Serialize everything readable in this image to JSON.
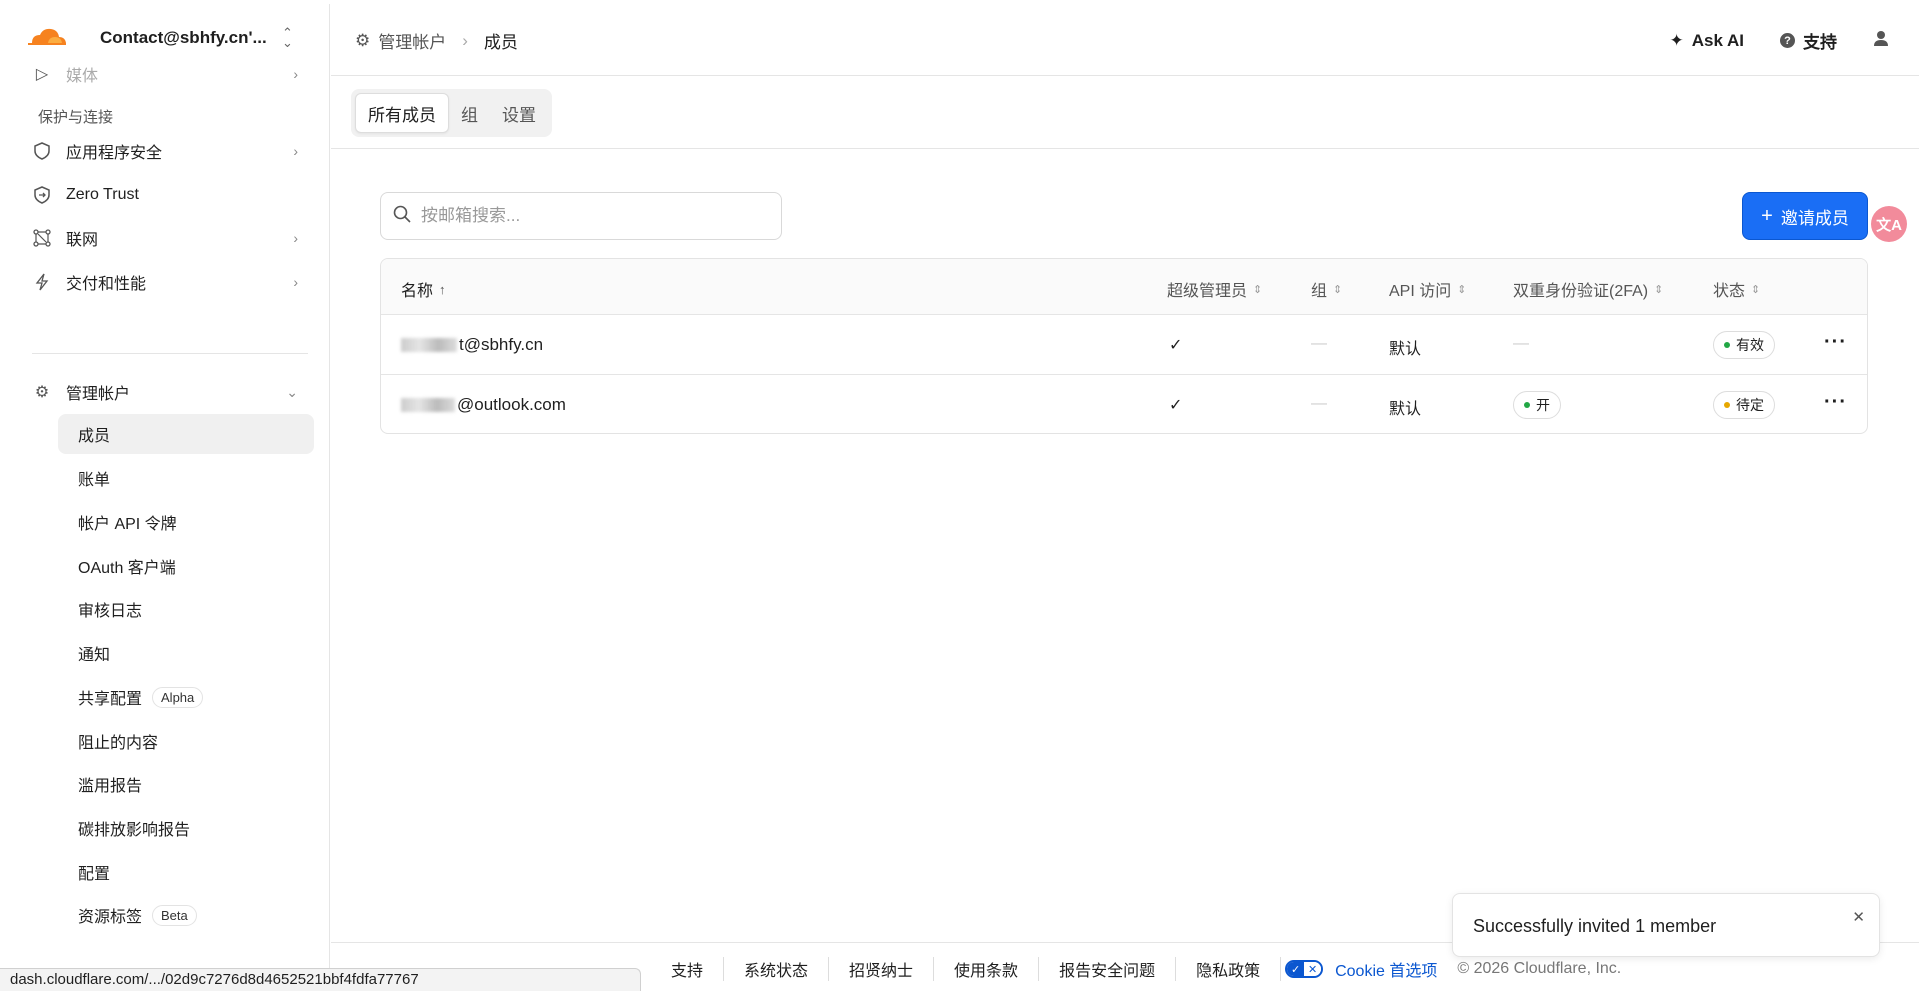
{
  "account": {
    "name": "Contact@sbhfy.cn'..."
  },
  "sidebar": {
    "partial_item": "媒体",
    "section_label": "保护与连接",
    "items": [
      {
        "label": "应用程序安全",
        "icon": "shield-icon"
      },
      {
        "label": "Zero Trust",
        "icon": "zero-trust-icon"
      },
      {
        "label": "联网",
        "icon": "network-icon"
      },
      {
        "label": "交付和性能",
        "icon": "lightning-icon"
      }
    ],
    "manage": {
      "label": "管理帐户",
      "icon": "gear-icon"
    },
    "sub_items": [
      {
        "label": "成员"
      },
      {
        "label": "账单"
      },
      {
        "label": "帐户 API 令牌"
      },
      {
        "label": "OAuth 客户端"
      },
      {
        "label": "审核日志"
      },
      {
        "label": "通知"
      },
      {
        "label": "共享配置",
        "tag": "Alpha"
      },
      {
        "label": "阻止的内容"
      },
      {
        "label": "滥用报告"
      },
      {
        "label": "碳排放影响报告"
      },
      {
        "label": "配置"
      },
      {
        "label": "资源标签",
        "tag": "Beta"
      }
    ]
  },
  "breadcrumb": {
    "parent": "管理帐户",
    "current": "成员"
  },
  "header": {
    "ask_ai": "Ask AI",
    "support": "支持"
  },
  "tabs": [
    {
      "label": "所有成员"
    },
    {
      "label": "组"
    },
    {
      "label": "设置"
    }
  ],
  "search": {
    "placeholder": "按邮箱搜索..."
  },
  "invite_button": "邀请成员",
  "table": {
    "columns": [
      "名称",
      "超级管理员",
      "组",
      "API 访问",
      "双重身份验证(2FA)",
      "状态"
    ],
    "rows": [
      {
        "email_visible": "t@sbhfy.cn",
        "super_admin": "✓",
        "group": "—",
        "api_access": "默认",
        "twofa": "—",
        "status": "有效",
        "status_color": "#22a745"
      },
      {
        "email_visible": "@outlook.com",
        "super_admin": "✓",
        "group": "—",
        "api_access": "默认",
        "twofa": "开",
        "twofa_color": "#22a745",
        "status": "待定",
        "status_color": "#e6a700"
      }
    ]
  },
  "footer": {
    "links": [
      "支持",
      "系统状态",
      "招贤纳士",
      "使用条款",
      "报告安全问题",
      "隐私政策"
    ],
    "cookie": "Cookie 首选项",
    "copyright": "© 2026 Cloudflare, Inc."
  },
  "status_url": "dash.cloudflare.com/.../02d9c7276d8d4652521bbf4fdfa77767",
  "toast": {
    "message": "Successfully invited 1 member"
  },
  "colors": {
    "accent": "#1a6ef5",
    "brand_orange": "#f6821f"
  }
}
